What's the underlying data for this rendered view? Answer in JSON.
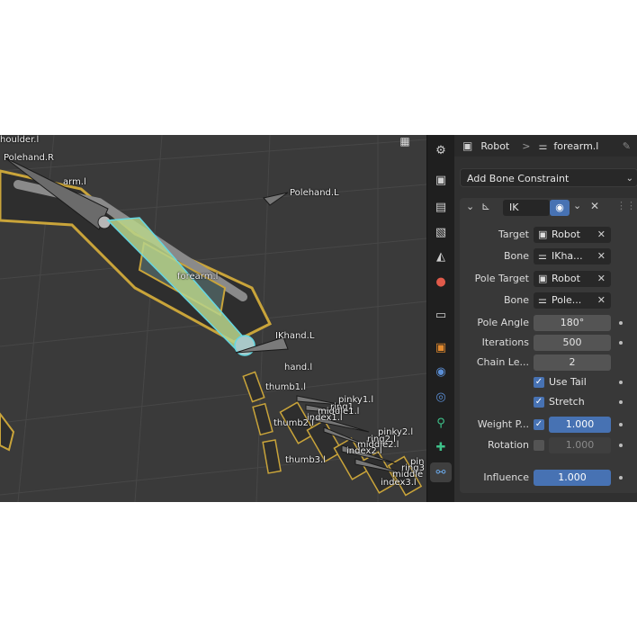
{
  "viewport": {
    "grid_icon": "grid-icon",
    "bone_labels": [
      "houlder.l",
      "Polehand.R",
      "arm.l",
      "Polehand.L",
      "forearm.l",
      "IKhand.L",
      "hand.l",
      "thumb1.l",
      "pinky1.l",
      "ring1",
      "middle1.l",
      "index1.l",
      "thumb2.l",
      "pinky2.l",
      "ring2.l",
      "middle2.l",
      "index2.l",
      "thumb3.l",
      "pin",
      "ring3",
      "middle",
      "index3.l"
    ]
  },
  "tabs": [
    {
      "icon": "tool-icon",
      "active": false
    },
    {
      "icon": "render-icon",
      "active": false
    },
    {
      "icon": "output-icon",
      "active": false
    },
    {
      "icon": "view-layer-icon",
      "active": false
    },
    {
      "icon": "scene-icon",
      "active": false
    },
    {
      "icon": "world-icon",
      "active": false
    },
    {
      "icon": "collection-icon",
      "active": false
    },
    {
      "icon": "object-icon",
      "active": false
    },
    {
      "icon": "modifier-icon",
      "active": false
    },
    {
      "icon": "physics-icon",
      "active": false
    },
    {
      "icon": "object-constraint-icon",
      "active": false
    },
    {
      "icon": "bone-icon",
      "active": false
    },
    {
      "icon": "bone-constraint-icon",
      "active": true
    }
  ],
  "properties": {
    "breadcrumb": {
      "object": "Robot",
      "separator": ">",
      "bone": "forearm.l"
    },
    "add_constraint_label": "Add Bone Constraint",
    "constraint": {
      "name": "IK",
      "target": {
        "label": "Target",
        "value": "Robot"
      },
      "bone": {
        "label": "Bone",
        "value": "IKha..."
      },
      "pole_target": {
        "label": "Pole Target",
        "value": "Robot"
      },
      "pole_bone": {
        "label": "Bone",
        "value": "Pole..."
      },
      "pole_angle": {
        "label": "Pole Angle",
        "value": "180°"
      },
      "iterations": {
        "label": "Iterations",
        "value": "500"
      },
      "chain_length": {
        "label": "Chain Le...",
        "value": "2"
      },
      "use_tail": {
        "label": "Use Tail",
        "checked": true
      },
      "stretch": {
        "label": "Stretch",
        "checked": true
      },
      "weight_position": {
        "label": "Weight P...",
        "checked": true,
        "value": "1.000"
      },
      "rotation": {
        "label": "Rotation",
        "checked": false,
        "value": "1.000"
      },
      "influence": {
        "label": "Influence",
        "value": "1.000"
      }
    }
  },
  "colors": {
    "accent": "#4772b3",
    "ik_chain": "#b7d38b",
    "arm_yellow": "#c9a43a"
  }
}
